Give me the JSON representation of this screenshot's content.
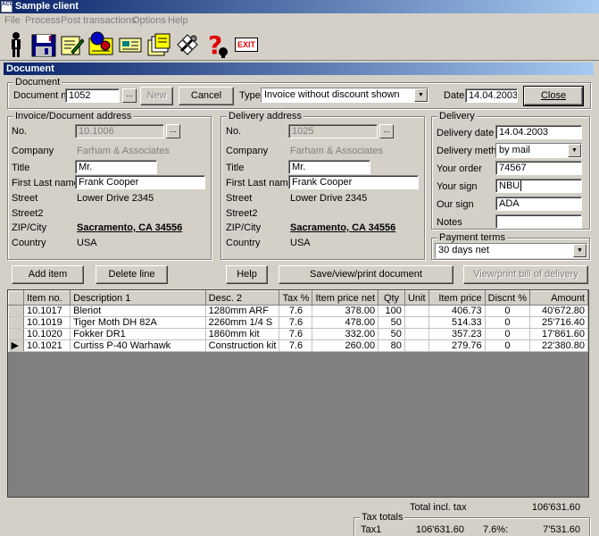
{
  "window": {
    "title": "Sample client",
    "icon_text": "ACC"
  },
  "menu": [
    "File",
    "Process",
    "Post transactions",
    "Options",
    "Help"
  ],
  "toolbar": {
    "exit_label": "EXIT"
  },
  "section_title": "Document",
  "document": {
    "group_title": "Document",
    "doc_no_label": "Document no.",
    "doc_no_value": "1052",
    "new_label": "New",
    "cancel_label": "Cancel",
    "type_label": "Type",
    "type_value": "Invoice without discount shown",
    "date_label": "Date",
    "date_value": "14.04.2003",
    "close_label": "Close"
  },
  "invoice_address": {
    "group_title": "Invoice/Document address",
    "no_label": "No.",
    "no_value": "10.1006",
    "company_label": "Company",
    "company_value": "Farham & Associates",
    "title_label": "Title",
    "title_value": "Mr.",
    "name_label": "First Last name",
    "name_value": "Frank Cooper",
    "street_label": "Street",
    "street_value": "Lower Drive 2345",
    "street2_label": "Street2",
    "zip_label": "ZIP/City",
    "zip_value": "Sacramento, CA 34556",
    "country_label": "Country",
    "country_value": "USA"
  },
  "delivery_address": {
    "group_title": "Delivery address",
    "no_label": "No.",
    "no_value": "1025",
    "company_label": "Company",
    "company_value": "Farham & Associates",
    "title_label": "Title",
    "title_value": "Mr.",
    "name_label": "First Last name",
    "name_value": "Frank Cooper",
    "street_label": "Street",
    "street_value": "Lower Drive 2345",
    "street2_label": "Street2",
    "zip_label": "ZIP/City",
    "zip_value": "Sacramento, CA 34556",
    "country_label": "Country",
    "country_value": "USA"
  },
  "delivery": {
    "group_title": "Delivery",
    "date_label": "Delivery date",
    "date_value": "14.04.2003",
    "method_label": "Delivery method",
    "method_value": "by mail",
    "your_order_label": "Your order",
    "your_order_value": "74567",
    "your_sign_label": "Your sign",
    "your_sign_value": "NBU",
    "our_sign_label": "Our sign",
    "our_sign_value": "ADA",
    "notes_label": "Notes",
    "notes_value": ""
  },
  "payment": {
    "group_title": "Payment terms",
    "value": "30 days net"
  },
  "actions": {
    "add_item": "Add item",
    "delete_line": "Delete line",
    "help": "Help",
    "save_print": "Save/view/print document",
    "print_delivery": "View/print bill of delivery"
  },
  "items": {
    "columns": [
      "Item no.",
      "Description 1",
      "Desc. 2",
      "Tax %",
      "Item price net",
      "Qty",
      "Unit",
      "Item price",
      "Discnt %",
      "Amount"
    ],
    "rows": [
      [
        "10.1017",
        "Bleriot",
        "1280mm ARF",
        "7.6",
        "378.00",
        "100",
        "",
        "406.73",
        "0",
        "40'672.80"
      ],
      [
        "10.1019",
        "Tiger Moth DH 82A",
        "2260mm 1/4 S",
        "7.6",
        "478.00",
        "50",
        "",
        "514.33",
        "0",
        "25'716.40"
      ],
      [
        "10.1020",
        "Fokker DR1",
        "1860mm kit",
        "7.6",
        "332.00",
        "50",
        "",
        "357.23",
        "0",
        "17'861.60"
      ],
      [
        "10.1021",
        "Curtiss P-40 Warhawk",
        "Construction kit",
        "7.6",
        "260.00",
        "80",
        "",
        "279.76",
        "0",
        "22'380.80"
      ]
    ]
  },
  "totals": {
    "total_label": "Total incl. tax",
    "total_value": "106'631.60",
    "tax_group_title": "Tax totals",
    "tax1_label": "Tax1",
    "tax1_base": "106'631.60",
    "tax1_rate": "7.6%:",
    "tax1_amount": "7'531.60"
  }
}
